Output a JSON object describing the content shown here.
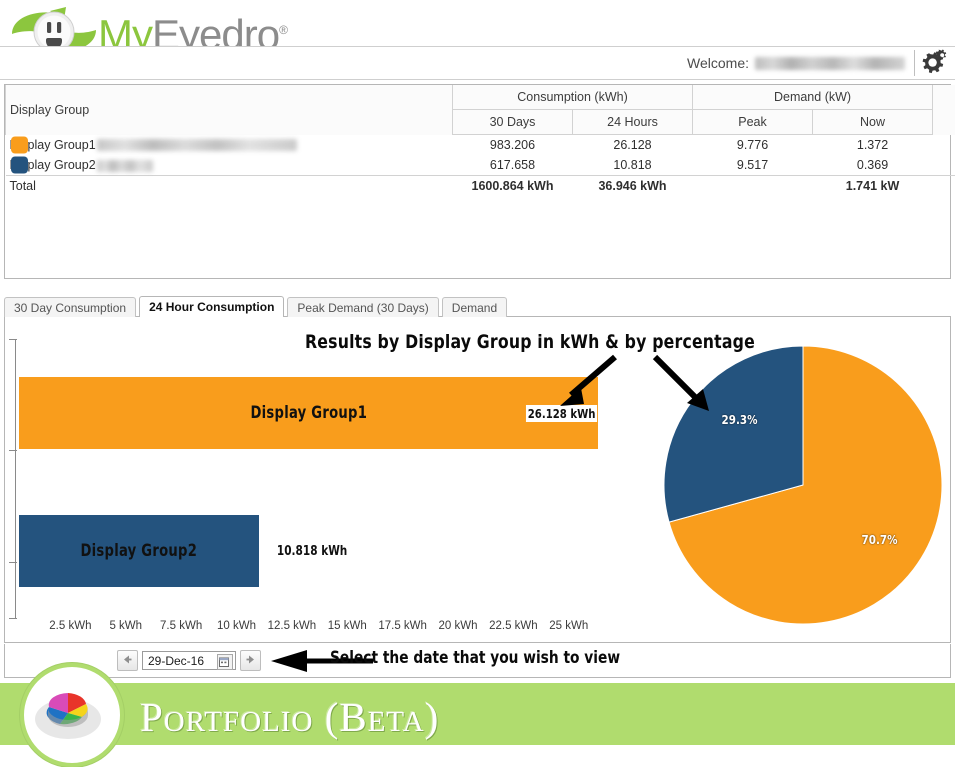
{
  "brand": {
    "name_part1": "My",
    "name_part2": "Eyedro",
    "registered": "®",
    "logo_icon": "outlet-smiley-icon"
  },
  "header": {
    "welcome_label": "Welcome:",
    "welcome_user_redacted": "",
    "settings_icon": "gear-icon"
  },
  "table": {
    "columns": {
      "display_group": "Display Group",
      "consumption_group": "Consumption (kWh)",
      "demand_group": "Demand (kW)",
      "sub_30_days": "30 Days",
      "sub_24_hours": "24 Hours",
      "sub_peak": "Peak",
      "sub_now": "Now"
    },
    "rows": [
      {
        "name": "Display Group1",
        "color": "#F99D1C",
        "consumption_30_days": "983.206",
        "consumption_24_hours": "26.128",
        "demand_peak": "9.776",
        "demand_now": "1.372"
      },
      {
        "name": "Display Group2",
        "color": "#24537E",
        "consumption_30_days": "617.658",
        "consumption_24_hours": "10.818",
        "demand_peak": "9.517",
        "demand_now": "0.369"
      }
    ],
    "total": {
      "label": "Total",
      "consumption_30_days": "1600.864 kWh",
      "consumption_24_hours": "36.946 kWh",
      "demand_peak": "",
      "demand_now": "1.741 kW"
    }
  },
  "tabs": [
    {
      "label": "30 Day Consumption",
      "active": false
    },
    {
      "label": "24 Hour Consumption",
      "active": true
    },
    {
      "label": "Peak Demand (30 Days)",
      "active": false
    },
    {
      "label": "Demand",
      "active": false
    }
  ],
  "annotations": {
    "chart_title": "Results by Display Group in kWh & by percentage",
    "date_hint": "Select the date that you wish to view",
    "arrow_to_bar_value": "arrow-icon",
    "arrow_to_pie": "arrow-icon",
    "arrow_to_datepicker": "arrow-icon"
  },
  "datepicker": {
    "value": "29-Dec-16",
    "prev_icon": "arrow-left-icon",
    "next_icon": "arrow-right-icon",
    "calendar_icon": "calendar-icon"
  },
  "footer": {
    "title": "Portfolio (Beta)",
    "logo_icon": "pie-chart-3d-icon",
    "background": "#B0DC6E"
  },
  "chart_data": [
    {
      "type": "bar",
      "orientation": "horizontal",
      "title": "Results by Display Group in kWh & by percentage",
      "xlabel": "",
      "ylabel": "",
      "categories": [
        "Display Group1",
        "Display Group2"
      ],
      "values": [
        26.128,
        10.818
      ],
      "value_labels": [
        "26.128 kWh",
        "10.818 kWh"
      ],
      "colors": [
        "#F99D1C",
        "#24537E"
      ],
      "xlim": [
        0,
        26.5
      ],
      "xticks": [
        2.5,
        5,
        7.5,
        10,
        12.5,
        15,
        17.5,
        20,
        22.5,
        25
      ],
      "xtick_labels": [
        "2.5 kWh",
        "5 kWh",
        "7.5 kWh",
        "10 kWh",
        "12.5 kWh",
        "15 kWh",
        "17.5 kWh",
        "20 kWh",
        "22.5 kWh",
        "25 kWh"
      ],
      "grid": false,
      "legend": false
    },
    {
      "type": "pie",
      "title": "",
      "labels": [
        "Display Group1",
        "Display Group2"
      ],
      "values": [
        70.7,
        29.3
      ],
      "value_labels": [
        "70.7%",
        "29.3%"
      ],
      "colors": [
        "#F99D1C",
        "#24537E"
      ],
      "start_angle_deg": 0,
      "direction": "clockwise",
      "legend": false
    }
  ]
}
